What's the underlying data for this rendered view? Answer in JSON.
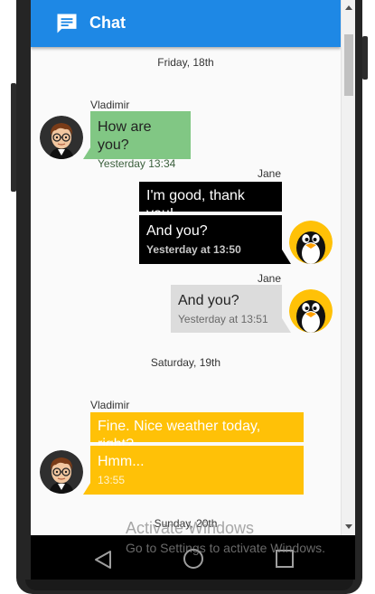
{
  "app": {
    "title": "Chat"
  },
  "dates": {
    "first": "Friday, 18th",
    "second": "Saturday, 19th",
    "third": "Sunday, 20th"
  },
  "messages": [
    {
      "sender": "Vladimir",
      "text": "How are you?",
      "time": "Yesterday 13:34"
    },
    {
      "sender": "Jane",
      "text": "I'm good, thank you!"
    },
    {
      "text": "And you?",
      "time": "Yesterday at 13:50"
    },
    {
      "sender": "Jane",
      "text": "And you?",
      "time": "Yesterday at 13:51"
    },
    {
      "sender": "Vladimir",
      "text": "Fine. Nice weather today, right?"
    },
    {
      "text": "Hmm...",
      "time": "13:55"
    }
  ],
  "watermark": {
    "line1": "Activate Windows",
    "line2": "Go to Settings to activate Windows."
  },
  "icons": {
    "app": "chat-icon",
    "back": "back-icon",
    "home": "home-icon",
    "recent": "recent-apps-icon"
  },
  "colors": {
    "appbar": "#1e88e5",
    "incoming": "#81c784",
    "outgoing": "#000000",
    "outgoing_alt": "#dcdcdc",
    "highlight": "#ffc107"
  }
}
